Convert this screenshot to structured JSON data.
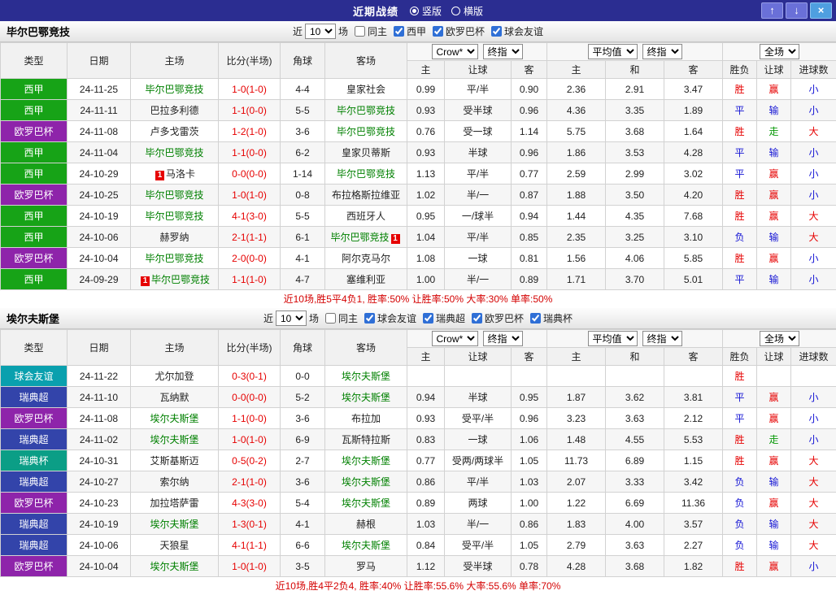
{
  "titlebar": {
    "title": "近期战绩",
    "radios": [
      {
        "label": "竖版",
        "selected": true
      },
      {
        "label": "横版",
        "selected": false
      }
    ],
    "buttons": [
      {
        "name": "move-up-button",
        "icon": "up-arrow-icon",
        "glyph": "↑"
      },
      {
        "name": "move-down-button",
        "icon": "down-arrow-icon",
        "glyph": "↓"
      },
      {
        "name": "close-button",
        "icon": "close-icon",
        "glyph": "×"
      }
    ]
  },
  "filter_labels": {
    "prefix": "近",
    "suffix": "场"
  },
  "table_headers": {
    "columns": [
      "类型",
      "日期",
      "主场",
      "比分(半场)",
      "角球",
      "客场"
    ],
    "subcolumns": [
      "主",
      "让球",
      "客",
      "主",
      "和",
      "客",
      "胜负",
      "让球",
      "进球数"
    ],
    "dropdown_groups": [
      [
        "Crow*",
        "终指"
      ],
      [
        "平均值",
        "终指"
      ],
      [
        "全场"
      ]
    ]
  },
  "colors": {
    "titlebar_bg": "#2b2d91",
    "score": "#e60000",
    "team_highlight": "#008000",
    "summary": "#d40000"
  },
  "league_colors": {
    "西甲": "#17a317",
    "欧罗巴杯": "#8e24aa",
    "球会友谊": "#0aa0ae",
    "瑞典超": "#3344aa",
    "瑞典杯": "#0b9e86"
  },
  "result_colors": {
    "r": "#e60000",
    "b": "#1414d4",
    "g": "#0a9a0a"
  },
  "sections": [
    {
      "team": "毕尔巴鄂竞技",
      "match_count": "10",
      "checkboxes": [
        {
          "label": "同主",
          "checked": false
        },
        {
          "label": "西甲",
          "checked": true
        },
        {
          "label": "欧罗巴杯",
          "checked": true
        },
        {
          "label": "球会友谊",
          "checked": true
        }
      ],
      "rows": [
        {
          "league": "西甲",
          "date": "24-11-25",
          "home": "毕尔巴鄂竞技",
          "home_hl": true,
          "score": "1-0(1-0)",
          "corner": "4-4",
          "away": "皇家社会",
          "odds": [
            "0.99",
            "平/半",
            "0.90"
          ],
          "avg": [
            "2.36",
            "2.91",
            "3.47"
          ],
          "res": [
            [
              "胜",
              "r"
            ],
            [
              "赢",
              "r"
            ],
            [
              "小",
              "b"
            ]
          ]
        },
        {
          "league": "西甲",
          "date": "24-11-11",
          "home": "巴拉多利德",
          "score": "1-1(0-0)",
          "corner": "5-5",
          "away": "毕尔巴鄂竞技",
          "away_hl": true,
          "odds": [
            "0.93",
            "受半球",
            "0.96"
          ],
          "avg": [
            "4.36",
            "3.35",
            "1.89"
          ],
          "res": [
            [
              "平",
              "b"
            ],
            [
              "输",
              "b"
            ],
            [
              "小",
              "b"
            ]
          ]
        },
        {
          "league": "欧罗巴杯",
          "date": "24-11-08",
          "home": "卢多戈雷茨",
          "score": "1-2(1-0)",
          "corner": "3-6",
          "away": "毕尔巴鄂竞技",
          "away_hl": true,
          "odds": [
            "0.76",
            "受一球",
            "1.14"
          ],
          "avg": [
            "5.75",
            "3.68",
            "1.64"
          ],
          "res": [
            [
              "胜",
              "r"
            ],
            [
              "走",
              "g"
            ],
            [
              "大",
              "r"
            ]
          ]
        },
        {
          "league": "西甲",
          "date": "24-11-04",
          "home": "毕尔巴鄂竞技",
          "home_hl": true,
          "score": "1-1(0-0)",
          "corner": "6-2",
          "away": "皇家贝蒂斯",
          "odds": [
            "0.93",
            "半球",
            "0.96"
          ],
          "avg": [
            "1.86",
            "3.53",
            "4.28"
          ],
          "res": [
            [
              "平",
              "b"
            ],
            [
              "输",
              "b"
            ],
            [
              "小",
              "b"
            ]
          ]
        },
        {
          "league": "西甲",
          "date": "24-10-29",
          "home": "马洛卡",
          "home_badge": "1",
          "home_badge_pos": "before",
          "score": "0-0(0-0)",
          "corner": "1-14",
          "away": "毕尔巴鄂竞技",
          "away_hl": true,
          "odds": [
            "1.13",
            "平/半",
            "0.77"
          ],
          "avg": [
            "2.59",
            "2.99",
            "3.02"
          ],
          "res": [
            [
              "平",
              "b"
            ],
            [
              "赢",
              "r"
            ],
            [
              "小",
              "b"
            ]
          ]
        },
        {
          "league": "欧罗巴杯",
          "date": "24-10-25",
          "home": "毕尔巴鄂竞技",
          "home_hl": true,
          "score": "1-0(1-0)",
          "corner": "0-8",
          "away": "布拉格斯拉维亚",
          "odds": [
            "1.02",
            "半/一",
            "0.87"
          ],
          "avg": [
            "1.88",
            "3.50",
            "4.20"
          ],
          "res": [
            [
              "胜",
              "r"
            ],
            [
              "赢",
              "r"
            ],
            [
              "小",
              "b"
            ]
          ]
        },
        {
          "league": "西甲",
          "date": "24-10-19",
          "home": "毕尔巴鄂竞技",
          "home_hl": true,
          "score": "4-1(3-0)",
          "corner": "5-5",
          "away": "西班牙人",
          "odds": [
            "0.95",
            "一/球半",
            "0.94"
          ],
          "avg": [
            "1.44",
            "4.35",
            "7.68"
          ],
          "res": [
            [
              "胜",
              "r"
            ],
            [
              "赢",
              "r"
            ],
            [
              "大",
              "r"
            ]
          ]
        },
        {
          "league": "西甲",
          "date": "24-10-06",
          "home": "赫罗纳",
          "score": "2-1(1-1)",
          "corner": "6-1",
          "away": "毕尔巴鄂竞技",
          "away_hl": true,
          "away_badge": "1",
          "away_badge_pos": "after",
          "odds": [
            "1.04",
            "平/半",
            "0.85"
          ],
          "avg": [
            "2.35",
            "3.25",
            "3.10"
          ],
          "res": [
            [
              "负",
              "b"
            ],
            [
              "输",
              "b"
            ],
            [
              "大",
              "r"
            ]
          ]
        },
        {
          "league": "欧罗巴杯",
          "date": "24-10-04",
          "home": "毕尔巴鄂竞技",
          "home_hl": true,
          "score": "2-0(0-0)",
          "corner": "4-1",
          "away": "阿尔克马尔",
          "odds": [
            "1.08",
            "一球",
            "0.81"
          ],
          "avg": [
            "1.56",
            "4.06",
            "5.85"
          ],
          "res": [
            [
              "胜",
              "r"
            ],
            [
              "赢",
              "r"
            ],
            [
              "小",
              "b"
            ]
          ]
        },
        {
          "league": "西甲",
          "date": "24-09-29",
          "home": "毕尔巴鄂竞技",
          "home_hl": true,
          "home_badge": "1",
          "home_badge_pos": "before",
          "score": "1-1(1-0)",
          "corner": "4-7",
          "away": "塞维利亚",
          "odds": [
            "1.00",
            "半/一",
            "0.89"
          ],
          "avg": [
            "1.71",
            "3.70",
            "5.01"
          ],
          "res": [
            [
              "平",
              "b"
            ],
            [
              "输",
              "b"
            ],
            [
              "小",
              "b"
            ]
          ]
        }
      ],
      "summary": "近10场,胜5平4负1, 胜率:50% 让胜率:50% 大率:30% 单率:50%"
    },
    {
      "team": "埃尔夫斯堡",
      "match_count": "10",
      "checkboxes": [
        {
          "label": "同主",
          "checked": false
        },
        {
          "label": "球会友谊",
          "checked": true
        },
        {
          "label": "瑞典超",
          "checked": true
        },
        {
          "label": "欧罗巴杯",
          "checked": true
        },
        {
          "label": "瑞典杯",
          "checked": true
        }
      ],
      "rows": [
        {
          "league": "球会友谊",
          "date": "24-11-22",
          "home": "尤尔加登",
          "score": "0-3(0-1)",
          "corner": "0-0",
          "away": "埃尔夫斯堡",
          "away_hl": true,
          "odds": [
            "",
            "",
            ""
          ],
          "avg": [
            "",
            "",
            ""
          ],
          "res": [
            [
              "胜",
              "r"
            ],
            [
              "",
              ""
            ],
            [
              "",
              ""
            ]
          ]
        },
        {
          "league": "瑞典超",
          "date": "24-11-10",
          "home": "瓦纳默",
          "score": "0-0(0-0)",
          "corner": "5-2",
          "away": "埃尔夫斯堡",
          "away_hl": true,
          "odds": [
            "0.94",
            "半球",
            "0.95"
          ],
          "avg": [
            "1.87",
            "3.62",
            "3.81"
          ],
          "res": [
            [
              "平",
              "b"
            ],
            [
              "赢",
              "r"
            ],
            [
              "小",
              "b"
            ]
          ]
        },
        {
          "league": "欧罗巴杯",
          "date": "24-11-08",
          "home": "埃尔夫斯堡",
          "home_hl": true,
          "score": "1-1(0-0)",
          "corner": "3-6",
          "away": "布拉加",
          "odds": [
            "0.93",
            "受平/半",
            "0.96"
          ],
          "avg": [
            "3.23",
            "3.63",
            "2.12"
          ],
          "res": [
            [
              "平",
              "b"
            ],
            [
              "赢",
              "r"
            ],
            [
              "小",
              "b"
            ]
          ]
        },
        {
          "league": "瑞典超",
          "date": "24-11-02",
          "home": "埃尔夫斯堡",
          "home_hl": true,
          "score": "1-0(1-0)",
          "corner": "6-9",
          "away": "瓦斯特拉斯",
          "odds": [
            "0.83",
            "一球",
            "1.06"
          ],
          "avg": [
            "1.48",
            "4.55",
            "5.53"
          ],
          "res": [
            [
              "胜",
              "r"
            ],
            [
              "走",
              "g"
            ],
            [
              "小",
              "b"
            ]
          ]
        },
        {
          "league": "瑞典杯",
          "date": "24-10-31",
          "home": "艾斯基斯迈",
          "score": "0-5(0-2)",
          "corner": "2-7",
          "away": "埃尔夫斯堡",
          "away_hl": true,
          "odds": [
            "0.77",
            "受两/两球半",
            "1.05"
          ],
          "avg": [
            "11.73",
            "6.89",
            "1.15"
          ],
          "res": [
            [
              "胜",
              "r"
            ],
            [
              "赢",
              "r"
            ],
            [
              "大",
              "r"
            ]
          ]
        },
        {
          "league": "瑞典超",
          "date": "24-10-27",
          "home": "索尔纳",
          "score": "2-1(1-0)",
          "corner": "3-6",
          "away": "埃尔夫斯堡",
          "away_hl": true,
          "odds": [
            "0.86",
            "平/半",
            "1.03"
          ],
          "avg": [
            "2.07",
            "3.33",
            "3.42"
          ],
          "res": [
            [
              "负",
              "b"
            ],
            [
              "输",
              "b"
            ],
            [
              "大",
              "r"
            ]
          ]
        },
        {
          "league": "欧罗巴杯",
          "date": "24-10-23",
          "home": "加拉塔萨雷",
          "score": "4-3(3-0)",
          "corner": "5-4",
          "away": "埃尔夫斯堡",
          "away_hl": true,
          "odds": [
            "0.89",
            "两球",
            "1.00"
          ],
          "avg": [
            "1.22",
            "6.69",
            "11.36"
          ],
          "res": [
            [
              "负",
              "b"
            ],
            [
              "赢",
              "r"
            ],
            [
              "大",
              "r"
            ]
          ]
        },
        {
          "league": "瑞典超",
          "date": "24-10-19",
          "home": "埃尔夫斯堡",
          "home_hl": true,
          "score": "1-3(0-1)",
          "corner": "4-1",
          "away": "赫根",
          "odds": [
            "1.03",
            "半/一",
            "0.86"
          ],
          "avg": [
            "1.83",
            "4.00",
            "3.57"
          ],
          "res": [
            [
              "负",
              "b"
            ],
            [
              "输",
              "b"
            ],
            [
              "大",
              "r"
            ]
          ]
        },
        {
          "league": "瑞典超",
          "date": "24-10-06",
          "home": "天狼星",
          "score": "4-1(1-1)",
          "corner": "6-6",
          "away": "埃尔夫斯堡",
          "away_hl": true,
          "odds": [
            "0.84",
            "受平/半",
            "1.05"
          ],
          "avg": [
            "2.79",
            "3.63",
            "2.27"
          ],
          "res": [
            [
              "负",
              "b"
            ],
            [
              "输",
              "b"
            ],
            [
              "大",
              "r"
            ]
          ]
        },
        {
          "league": "欧罗巴杯",
          "date": "24-10-04",
          "home": "埃尔夫斯堡",
          "home_hl": true,
          "score": "1-0(1-0)",
          "corner": "3-5",
          "away": "罗马",
          "odds": [
            "1.12",
            "受半球",
            "0.78"
          ],
          "avg": [
            "4.28",
            "3.68",
            "1.82"
          ],
          "res": [
            [
              "胜",
              "r"
            ],
            [
              "赢",
              "r"
            ],
            [
              "小",
              "b"
            ]
          ]
        }
      ],
      "summary": "近10场,胜4平2负4, 胜率:40% 让胜率:55.6% 大率:55.6% 单率:70%"
    }
  ]
}
